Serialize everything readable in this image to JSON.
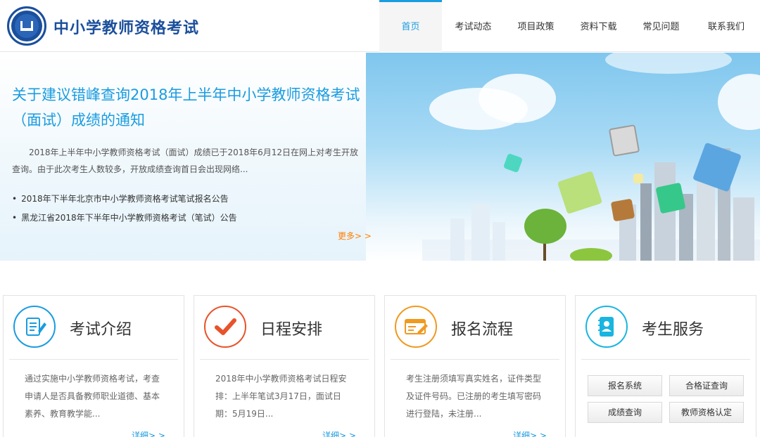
{
  "header": {
    "site_title": "中小学教师资格考试",
    "nav": [
      {
        "label": "首页",
        "active": true
      },
      {
        "label": "考试动态"
      },
      {
        "label": "项目政策"
      },
      {
        "label": "资料下载"
      },
      {
        "label": "常见问题"
      },
      {
        "label": "联系我们"
      }
    ]
  },
  "banner": {
    "title": "关于建议错峰查询2018年上半年中小学教师资格考试（面试）成绩的通知",
    "desc": "2018年上半年中小学教师资格考试（面试）成绩已于2018年6月12日在网上对考生开放查询。由于此次考生人数较多，开放成绩查询首日会出现网络...",
    "links": [
      "2018年下半年北京市中小学教师资格考试笔试报名公告",
      "黑龙江省2018年下半年中小学教师资格考试（笔试）公告"
    ],
    "more": "更多> >"
  },
  "cards": [
    {
      "title": "考试介绍",
      "icon": "document-edit-icon",
      "text": "通过实施中小学教师资格考试，考查申请人是否具备教师职业道德、基本素养、教育教学能...",
      "more": "详细> >"
    },
    {
      "title": "日程安排",
      "icon": "checkmark-icon",
      "text": "2018年中小学教师资格考试日程安排：上半年笔试3月17日，面试日期：5月19日...",
      "more": "详细> >"
    },
    {
      "title": "报名流程",
      "icon": "form-pen-icon",
      "text": "考生注册须填写真实姓名，证件类型及证件号码。已注册的考生填写密码进行登陆，未注册...",
      "more": "详细> >"
    },
    {
      "title": "考生服务",
      "icon": "contact-book-icon",
      "buttons": [
        "报名系统",
        "合格证查询",
        "成绩查询",
        "教师资格认定"
      ]
    }
  ],
  "colors": {
    "brand": "#1b4f9c",
    "accent": "#1a9ce0",
    "orange": "#ff7e00",
    "icon_red": "#e8532b",
    "icon_orange": "#f09a1f",
    "icon_cyan": "#19b5e0"
  }
}
